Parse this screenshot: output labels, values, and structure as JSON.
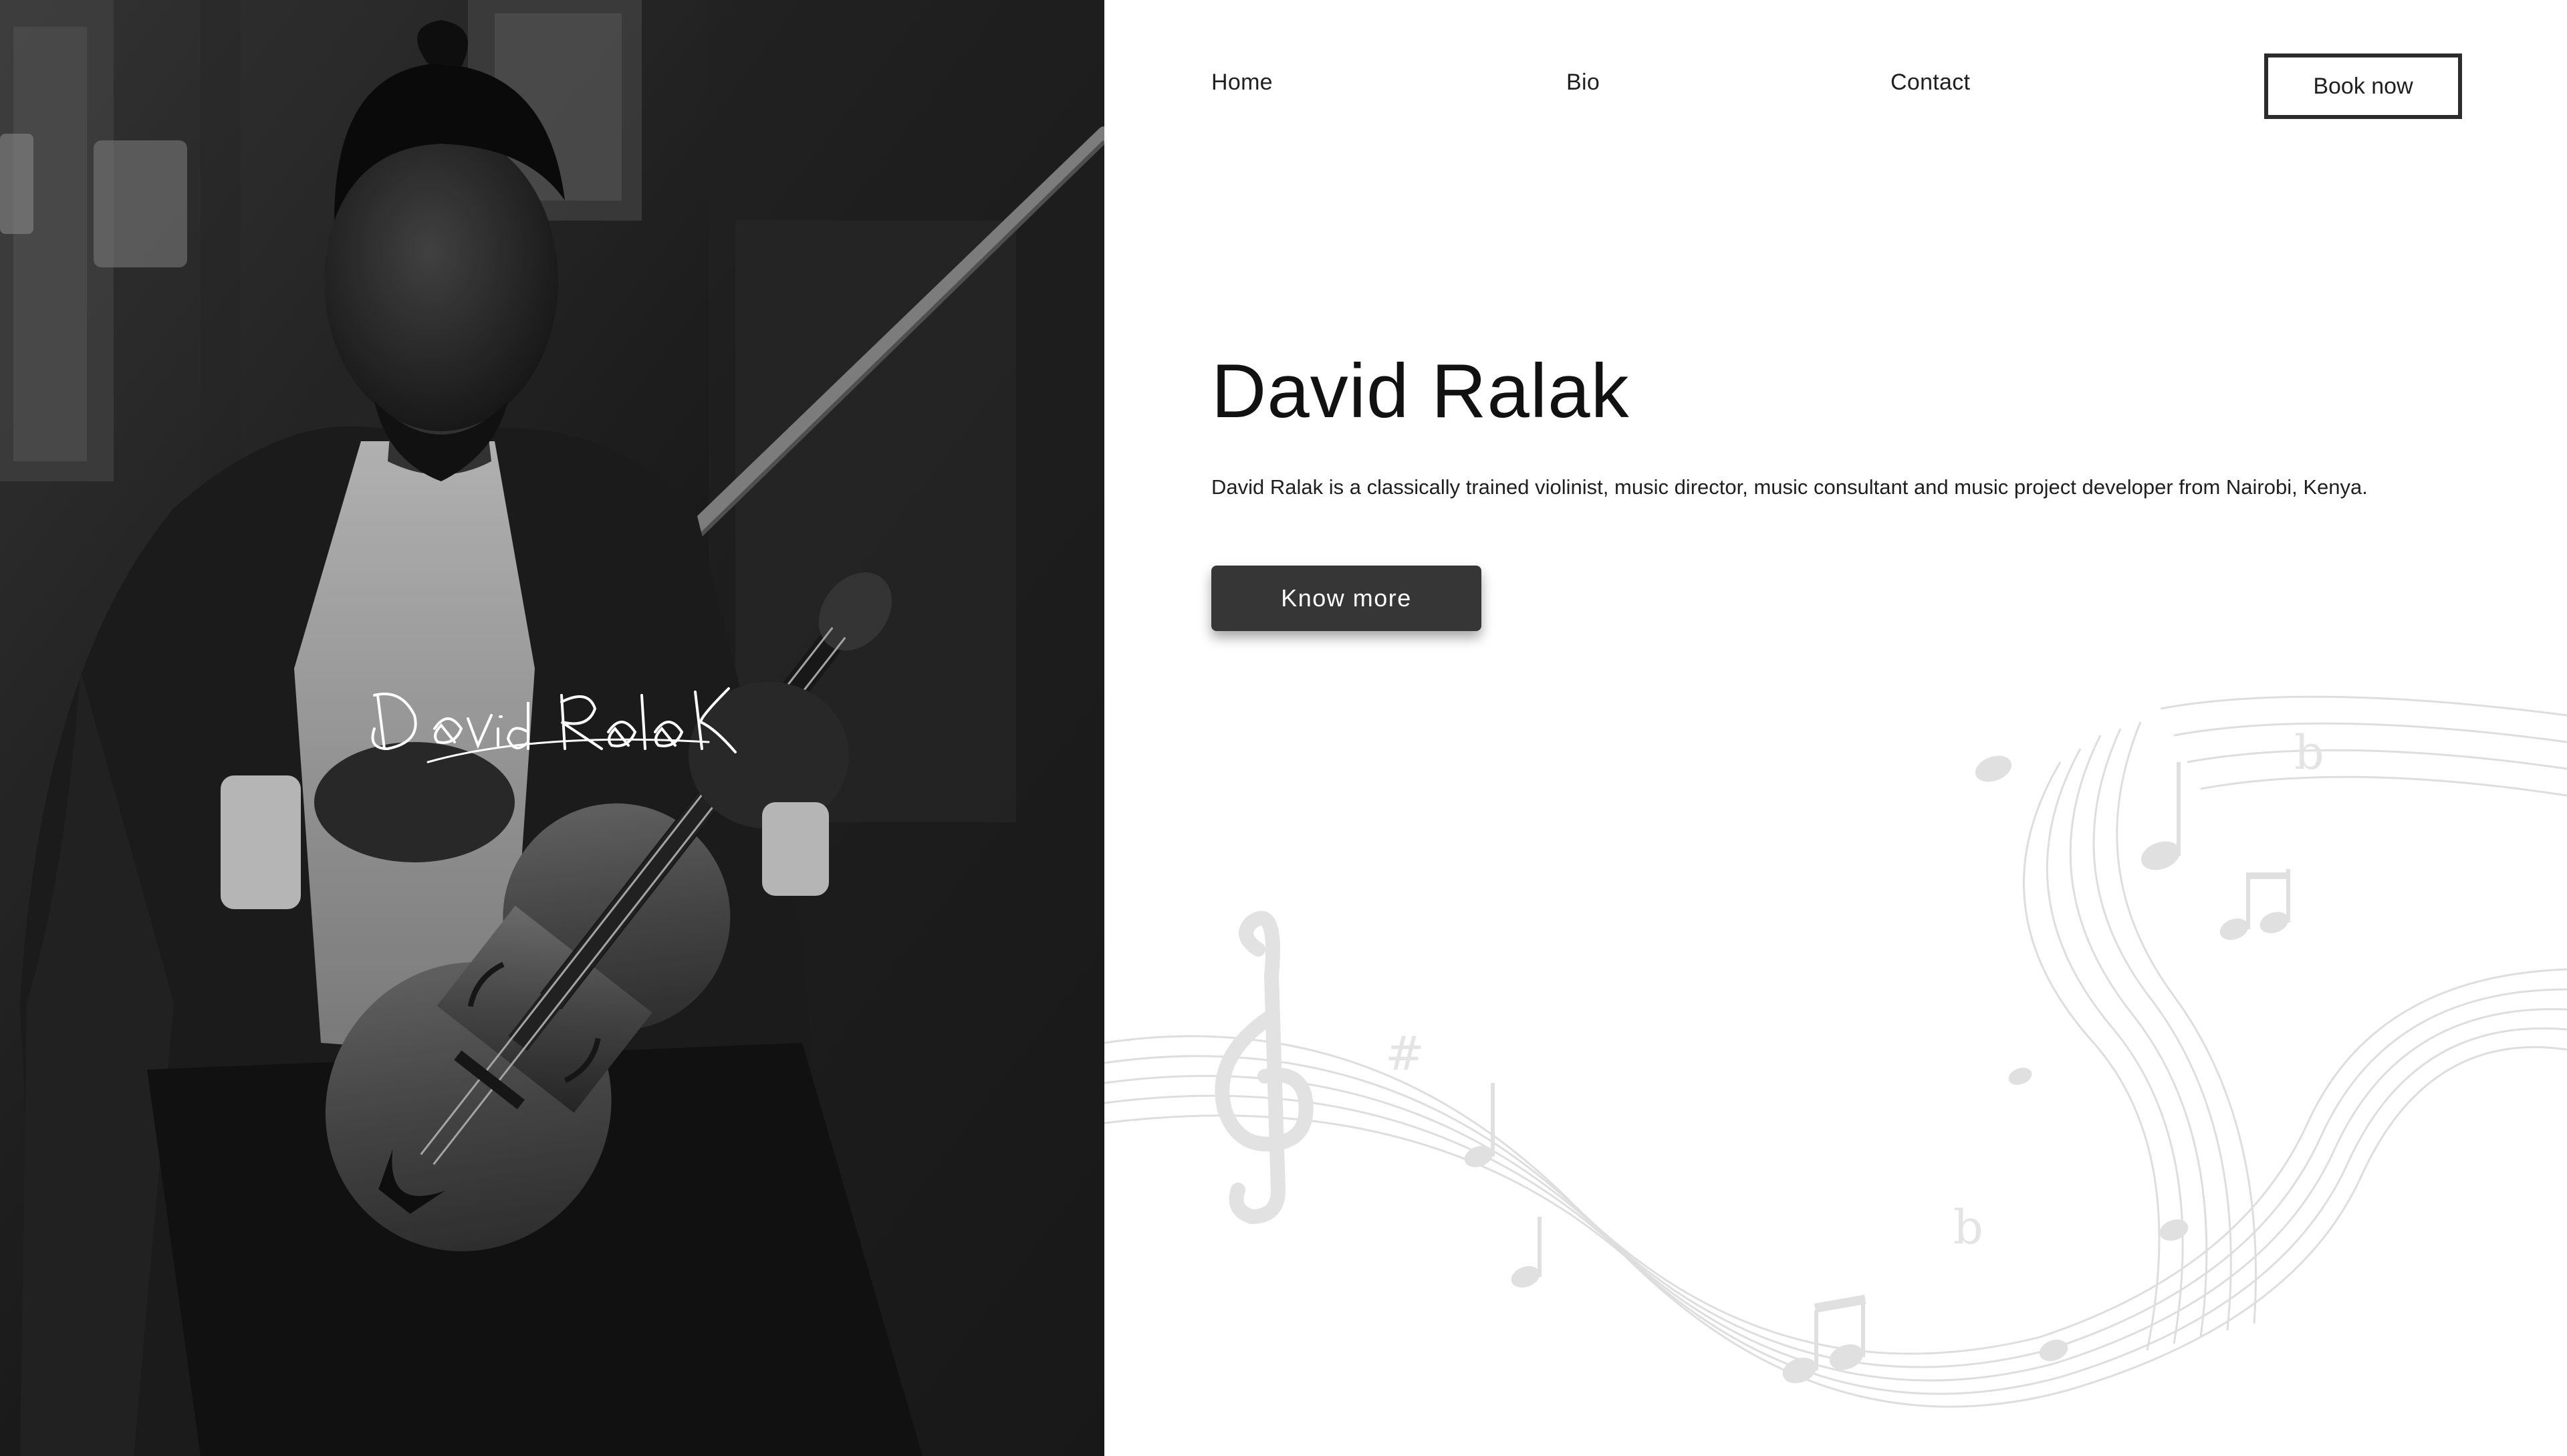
{
  "nav": {
    "home": "Home",
    "bio": "Bio",
    "contact": "Contact",
    "book_now": "Book now"
  },
  "hero": {
    "title": "David Ralak",
    "description": "David Ralak is a classically trained violinist, music director, music consultant and music project developer from Nairobi, Kenya.",
    "cta": "Know more"
  },
  "photo": {
    "signature": "David RalaK"
  },
  "colors": {
    "button_dark": "#363636",
    "text": "#1f1f1f",
    "background": "#ffffff",
    "photo_bg": "#161616"
  }
}
